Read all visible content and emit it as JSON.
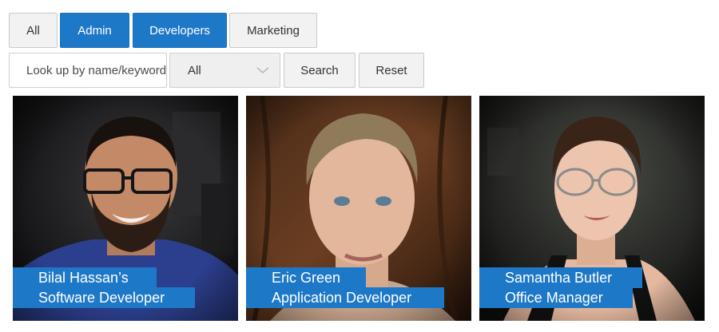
{
  "filters": {
    "tabs": [
      {
        "label": "All",
        "active": false
      },
      {
        "label": "Admin",
        "active": true
      },
      {
        "label": "Developers",
        "active": true
      },
      {
        "label": "Marketing",
        "active": false
      }
    ]
  },
  "search": {
    "placeholder": "Look up by name/keyword",
    "category": "All",
    "search_label": "Search",
    "reset_label": "Reset"
  },
  "team": [
    {
      "name": "Bilal Hassan’s",
      "role": "Software Developer"
    },
    {
      "name": "Eric Green",
      "role": "Application Developer"
    },
    {
      "name": "Samantha Butler",
      "role": "Office Manager"
    }
  ],
  "colors": {
    "accent": "#1e78c8",
    "button_bg": "#f2f2f2",
    "border": "#c9c9c9"
  }
}
